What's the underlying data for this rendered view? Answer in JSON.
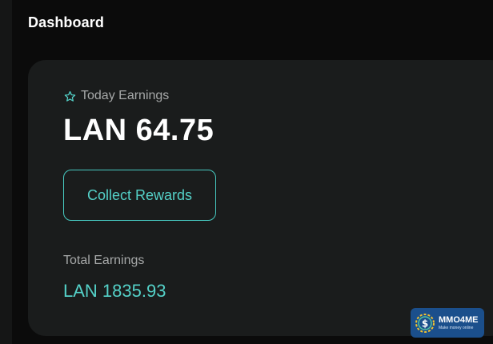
{
  "header": {
    "title": "Dashboard"
  },
  "earnings_card": {
    "today_label": "Today Earnings",
    "today_value": "LAN 64.75",
    "collect_button_label": "Collect Rewards",
    "total_label": "Total Earnings",
    "total_value": "LAN 1835.93"
  },
  "icons": {
    "today": "star-icon",
    "watermark": "dollar-coin-icon"
  },
  "watermark": {
    "name": "MMO4ME",
    "tagline": "Make money online"
  },
  "colors": {
    "background": "#0b0b0b",
    "card": "#1a1c1c",
    "accent": "#54d1c8",
    "muted_text": "#a6a8a8",
    "watermark_bg": "#1b4f8c"
  }
}
